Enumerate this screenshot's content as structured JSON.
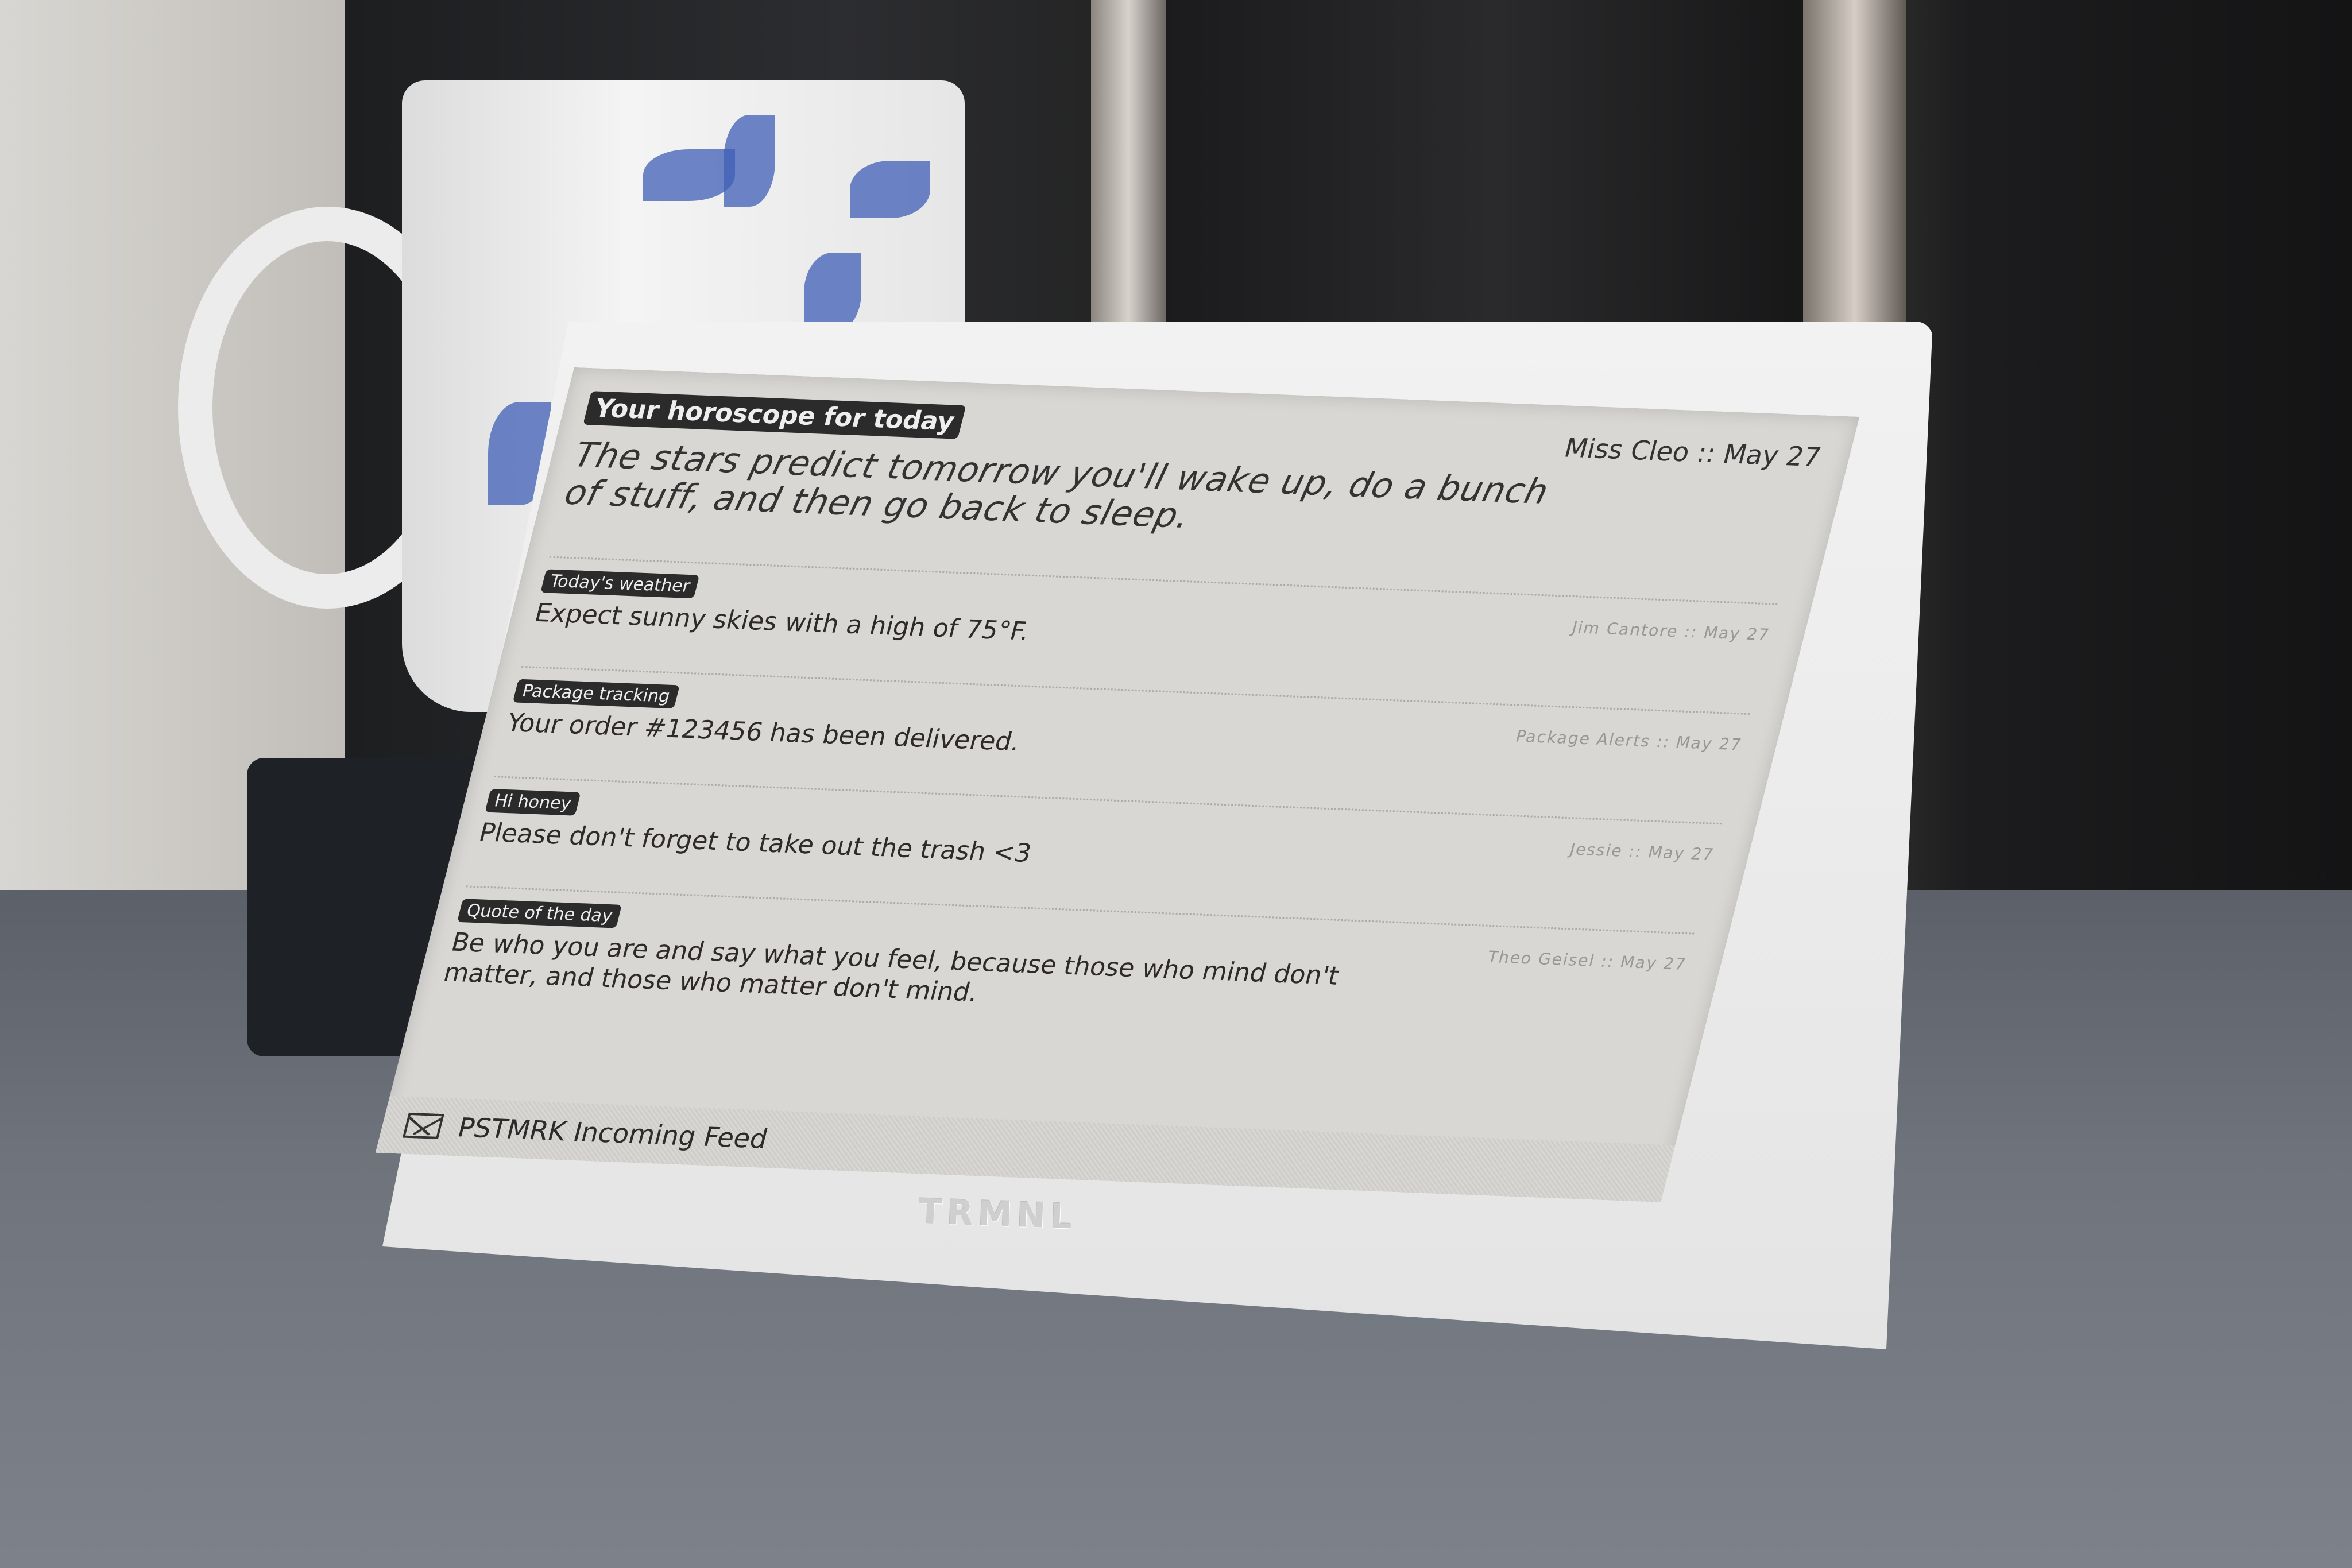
{
  "device": {
    "brand": "TRMNL",
    "header": {
      "title": "Your horoscope for today",
      "meta": "Miss Cleo :: May 27",
      "message": "The stars predict tomorrow you'll wake up, do a bunch of stuff, and then go back to sleep."
    },
    "items": [
      {
        "label": "Today's weather",
        "text": "Expect sunny skies with a high of 75°F.",
        "meta": "Jim Cantore :: May 27"
      },
      {
        "label": "Package tracking",
        "text": "Your order #123456 has been delivered.",
        "meta": "Package Alerts :: May 27"
      },
      {
        "label": "Hi honey",
        "text": "Please don't forget to take out the trash <3",
        "meta": "Jessie :: May 27"
      },
      {
        "label": "Quote of the day",
        "text": "Be who you are and say what you feel, because those who mind don't matter, and those who matter don't mind.",
        "meta": "Theo Geisel :: May 27"
      }
    ],
    "footer": {
      "icon": "envelope-icon",
      "label": "PSTMRK Incoming Feed"
    }
  }
}
